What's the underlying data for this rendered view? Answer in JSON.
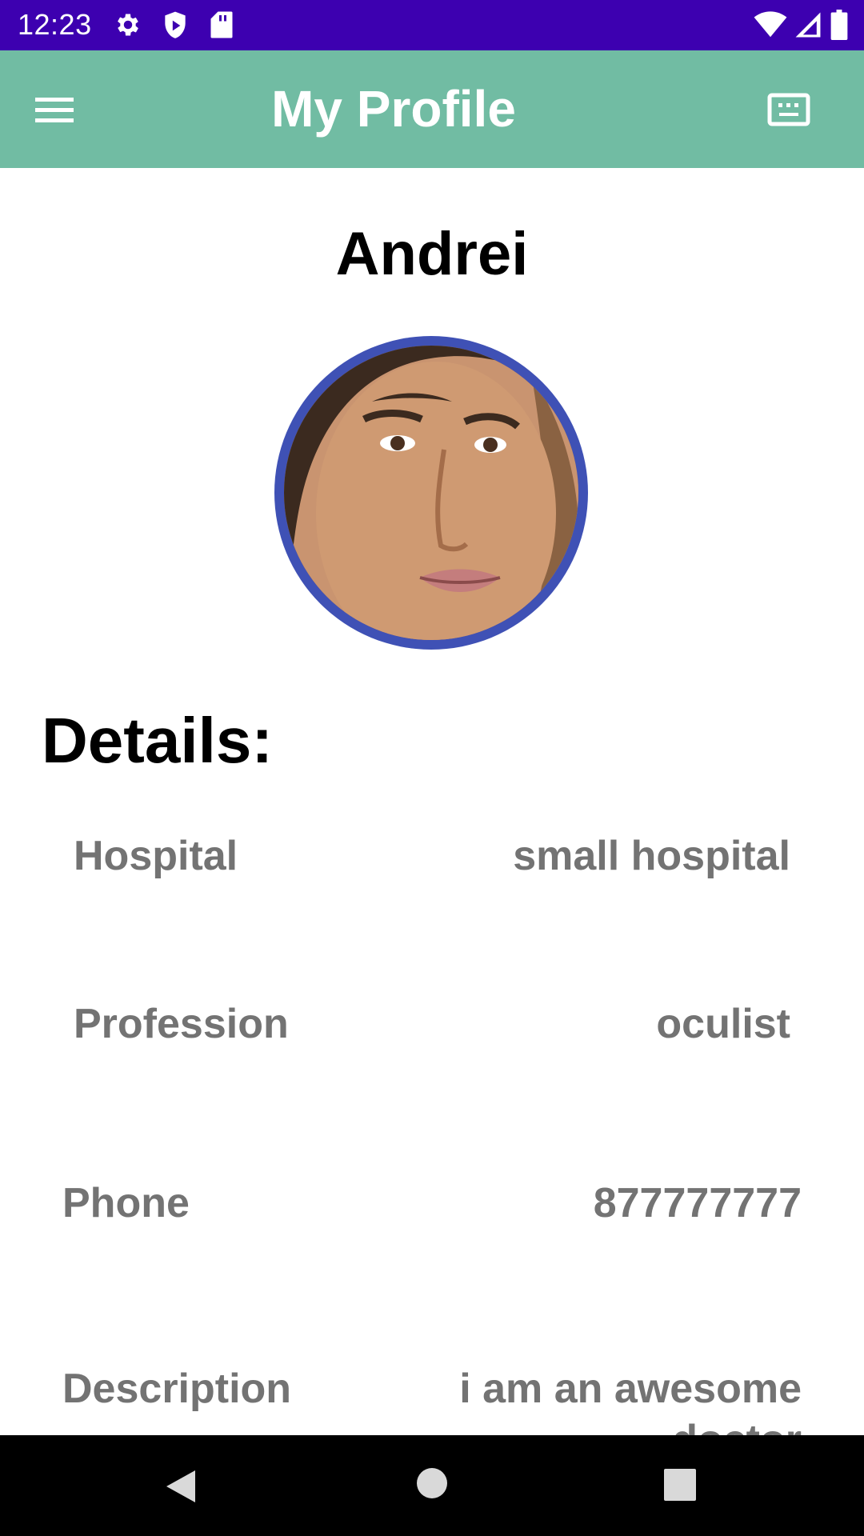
{
  "status_bar": {
    "time": "12:23",
    "icons": [
      "gear-icon",
      "shield-icon",
      "sd-card-icon",
      "wifi-icon",
      "signal-icon",
      "battery-icon"
    ],
    "background_color": "#3d00b0"
  },
  "app_bar": {
    "title": "My Profile",
    "menu_icon": "menu-icon",
    "action_icon": "keyboard-icon",
    "background_color": "#71bca3"
  },
  "profile": {
    "name": "Andrei",
    "avatar_ring_color": "#3f51b5"
  },
  "details": {
    "heading": "Details:",
    "rows": [
      {
        "label": "Hospital",
        "value": "small hospital"
      },
      {
        "label": "Profession",
        "value": "oculist"
      },
      {
        "label": "Phone",
        "value": "877777777"
      },
      {
        "label": "Description",
        "value": "i am an awesome doctor"
      }
    ]
  },
  "nav_bar": {
    "icons": [
      "back-icon",
      "home-icon",
      "recents-icon"
    ]
  }
}
